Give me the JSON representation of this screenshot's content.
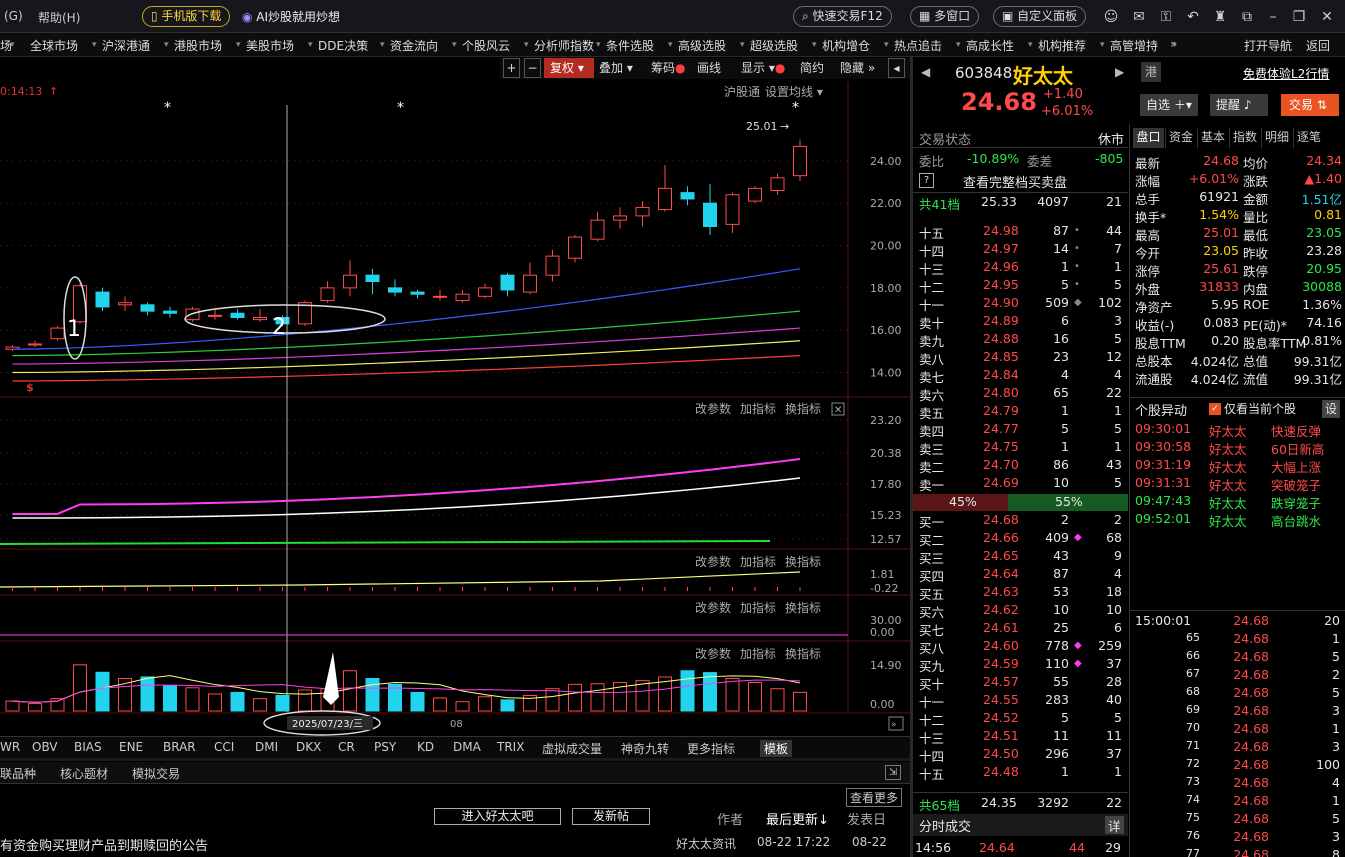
{
  "menu": {
    "left": "(G)",
    "help": "帮助(H)",
    "mobile": "手机版下载",
    "ai": "AI炒股就用炒想",
    "quick_trade": "快速交易F12",
    "multi_window": "多窗口",
    "custom_panel": "自定义面板"
  },
  "nav": [
    "场",
    "全球市场",
    "沪深港通",
    "港股市场",
    "美股市场",
    "DDE决策",
    "资金流向",
    "个股风云",
    "分析师指数",
    "条件选股",
    "高级选股",
    "超级选股",
    "机构增仓",
    "热点追击",
    "高成长性",
    "机构推荐",
    "高管增持"
  ],
  "nav_right": {
    "more": "»",
    "open_nav": "打开导航",
    "back": "返回"
  },
  "chart": {
    "toolbar": {
      "fuquan": "复权",
      "diejia": "叠加",
      "chouma": "筹码",
      "huaxian": "画线",
      "xianshi": "显示",
      "jianyue": "简约",
      "yincang": "隐藏"
    },
    "time_label": "0:14:13",
    "hgt": "沪股通",
    "ma_setting": "设置均线",
    "price_axis": [
      "24.00",
      "22.00",
      "20.00",
      "18.00",
      "16.00",
      "14.00"
    ],
    "high_label": "25.01",
    "annotations": [
      "1",
      "2"
    ],
    "panel_buttons": [
      "改参数",
      "加指标",
      "换指标"
    ],
    "p2_axis": [
      "23.20",
      "20.38",
      "17.80",
      "15.23",
      "12.57"
    ],
    "p3_axis": [
      "1.81",
      "-0.22"
    ],
    "p4_axis": [
      "30.00",
      "0.00"
    ],
    "p5_axis": [
      "14.90",
      "0.00"
    ],
    "date_label": "2025/07/23/三",
    "month_label": "08",
    "dollar_mark": "$"
  },
  "chart_data": {
    "type": "candlestick",
    "ohlc": [
      [
        15.1,
        15.3,
        15.0,
        15.2
      ],
      [
        15.3,
        15.5,
        15.2,
        15.35
      ],
      [
        15.6,
        16.2,
        15.5,
        16.1
      ],
      [
        16.4,
        18.2,
        16.3,
        18.1
      ],
      [
        17.8,
        18.0,
        16.9,
        17.1
      ],
      [
        17.2,
        17.6,
        16.9,
        17.3
      ],
      [
        17.2,
        17.3,
        16.7,
        16.9
      ],
      [
        16.9,
        17.1,
        16.6,
        16.8
      ],
      [
        16.5,
        17.1,
        16.4,
        17.0
      ],
      [
        16.7,
        17.0,
        16.5,
        16.7
      ],
      [
        16.8,
        17.0,
        16.5,
        16.6
      ],
      [
        16.5,
        17.0,
        16.4,
        16.6
      ],
      [
        16.6,
        16.7,
        16.2,
        16.3
      ],
      [
        16.3,
        17.4,
        16.2,
        17.3
      ],
      [
        17.4,
        18.3,
        17.3,
        18.0
      ],
      [
        18.0,
        19.3,
        17.6,
        18.6
      ],
      [
        18.6,
        18.9,
        17.7,
        18.3
      ],
      [
        18.0,
        18.4,
        17.6,
        17.8
      ],
      [
        17.8,
        17.9,
        17.5,
        17.7
      ],
      [
        17.6,
        17.9,
        17.4,
        17.6
      ],
      [
        17.4,
        17.9,
        17.3,
        17.7
      ],
      [
        17.6,
        18.2,
        17.5,
        18.0
      ],
      [
        18.6,
        18.7,
        17.6,
        17.9
      ],
      [
        17.8,
        19.2,
        17.7,
        18.6
      ],
      [
        18.6,
        19.8,
        18.3,
        19.5
      ],
      [
        19.4,
        20.5,
        19.2,
        20.4
      ],
      [
        20.3,
        21.6,
        20.2,
        21.2
      ],
      [
        21.2,
        21.8,
        20.8,
        21.4
      ],
      [
        21.4,
        22.1,
        20.9,
        21.8
      ],
      [
        21.7,
        23.8,
        21.6,
        22.7
      ],
      [
        22.5,
        22.8,
        21.9,
        22.2
      ],
      [
        22.0,
        22.9,
        20.5,
        20.9
      ],
      [
        21.0,
        22.5,
        20.6,
        22.4
      ],
      [
        22.1,
        22.8,
        22.0,
        22.7
      ],
      [
        22.6,
        23.4,
        22.4,
        23.2
      ],
      [
        23.3,
        25.01,
        23.05,
        24.68
      ]
    ],
    "ma_lines": [
      {
        "color": "#3a5bff"
      },
      {
        "color": "#2ecc40"
      },
      {
        "color": "#e040e0"
      },
      {
        "color": "#f0f060"
      },
      {
        "color": "#ff4040"
      }
    ],
    "volume": [
      3.2,
      2.4,
      4.0,
      14.9,
      12.5,
      10.5,
      11.0,
      8.2,
      7.5,
      5.5,
      6.0,
      4.0,
      5.0,
      6.8,
      7.2,
      13.0,
      10.5,
      8.6,
      6.0,
      4.2,
      3.0,
      4.6,
      3.6,
      5.0,
      7.2,
      8.6,
      8.8,
      9.2,
      9.8,
      11.0,
      13.0,
      12.4,
      10.5,
      9.2,
      7.2,
      6.0
    ],
    "ylim": [
      13.6,
      25.6
    ]
  },
  "indicators": [
    "WR",
    "OBV",
    "BIAS",
    "ENE",
    "BRAR",
    "CCI",
    "DMI",
    "DKX",
    "CR",
    "PSY",
    "KD",
    "DMA",
    "TRIX",
    "虚拟成交量",
    "神奇九转",
    "更多指标",
    "模板"
  ],
  "bottom": {
    "tabs": [
      "联品种",
      "核心题材",
      "模拟交易"
    ],
    "more": "查看更多",
    "enter": "进入好太太吧",
    "post": "发新帖",
    "author": "作者",
    "last_update": "最后更新",
    "post_date": "发表日",
    "news1": "有资金购买理财产品到期赎回的公告",
    "news_src": "好太太资讯",
    "news_time": "08-22 17:22",
    "news_date": "08-22"
  },
  "stock": {
    "code": "603848",
    "name": "好太太",
    "price": "24.68",
    "change": "+1.40",
    "pct": "+6.01%",
    "hk": "港",
    "l2": "免费体验L2行情",
    "zixuan": "自选",
    "remind": "提醒",
    "trade": "交易"
  },
  "order": {
    "status_label": "交易状态",
    "status": "休市",
    "weibi_label": "委比",
    "weibi": "-10.89%",
    "weicha_label": "委差",
    "weicha": "-805",
    "full_book": "查看完整档买卖盘",
    "total_sell": [
      "共41档",
      "25.33",
      "4097",
      "21"
    ],
    "sells": [
      [
        "十五",
        "24.98",
        "87",
        "44"
      ],
      [
        "十四",
        "24.97",
        "14",
        "7"
      ],
      [
        "十三",
        "24.96",
        "1",
        "1"
      ],
      [
        "十二",
        "24.95",
        "5",
        "5"
      ],
      [
        "十一",
        "24.90",
        "509",
        "102"
      ],
      [
        "卖十",
        "24.89",
        "6",
        "3"
      ],
      [
        "卖九",
        "24.88",
        "16",
        "5"
      ],
      [
        "卖八",
        "24.85",
        "23",
        "12"
      ],
      [
        "卖七",
        "24.84",
        "4",
        "4"
      ],
      [
        "卖六",
        "24.80",
        "65",
        "22"
      ],
      [
        "卖五",
        "24.79",
        "1",
        "1"
      ],
      [
        "卖四",
        "24.77",
        "5",
        "5"
      ],
      [
        "卖三",
        "24.75",
        "1",
        "1"
      ],
      [
        "卖二",
        "24.70",
        "86",
        "43"
      ],
      [
        "卖一",
        "24.69",
        "10",
        "5"
      ]
    ],
    "ratio_left": "45%",
    "ratio_right": "55%",
    "buys": [
      [
        "买一",
        "24.68",
        "2",
        "2"
      ],
      [
        "买二",
        "24.66",
        "409",
        "68"
      ],
      [
        "买三",
        "24.65",
        "43",
        "9"
      ],
      [
        "买四",
        "24.64",
        "87",
        "4"
      ],
      [
        "买五",
        "24.63",
        "53",
        "18"
      ],
      [
        "买六",
        "24.62",
        "10",
        "10"
      ],
      [
        "买七",
        "24.61",
        "25",
        "6"
      ],
      [
        "买八",
        "24.60",
        "778",
        "259"
      ],
      [
        "买九",
        "24.59",
        "110",
        "37"
      ],
      [
        "买十",
        "24.57",
        "55",
        "28"
      ],
      [
        "十一",
        "24.55",
        "283",
        "40"
      ],
      [
        "十二",
        "24.52",
        "5",
        "5"
      ],
      [
        "十三",
        "24.51",
        "11",
        "11"
      ],
      [
        "十四",
        "24.50",
        "296",
        "37"
      ],
      [
        "十五",
        "24.48",
        "1",
        "1"
      ]
    ],
    "total_buy": [
      "共65档",
      "24.35",
      "3292",
      "22"
    ],
    "fenshi_label": "分时成交",
    "detail": "详",
    "last_trade": [
      "14:56",
      "24.64",
      "44",
      "29"
    ]
  },
  "tabs": [
    "盘口",
    "资金",
    "基本",
    "指数",
    "明细",
    "逐笔"
  ],
  "quote": [
    [
      "最新",
      "24.68",
      "均价",
      "24.34"
    ],
    [
      "涨幅",
      "+6.01%",
      "涨跌",
      "▲1.40"
    ],
    [
      "总手",
      "61921",
      "金额",
      "1.51亿"
    ],
    [
      "换手*",
      "1.54%",
      "量比",
      "0.81"
    ],
    [
      "最高",
      "25.01",
      "最低",
      "23.05"
    ],
    [
      "今开",
      "23.05",
      "昨收",
      "23.28"
    ],
    [
      "涨停",
      "25.61",
      "跌停",
      "20.95"
    ],
    [
      "外盘",
      "31833",
      "内盘",
      "30088"
    ],
    [
      "净资产",
      "5.95",
      "ROE",
      "1.36%"
    ],
    [
      "收益(-)",
      "0.083",
      "PE(动)*",
      "74.16"
    ],
    [
      "股息TTM",
      "0.20",
      "股息率TTM",
      "0.81%"
    ],
    [
      "总股本",
      "4.024亿",
      "总值",
      "99.31亿"
    ],
    [
      "流通股",
      "4.024亿",
      "流值",
      "99.31亿"
    ]
  ],
  "alerts": {
    "title": "个股异动",
    "only": "仅看当前个股",
    "settings": "设",
    "rows": [
      [
        "09:30:01",
        "好太太",
        "快速反弹"
      ],
      [
        "09:30:58",
        "好太太",
        "60日新高"
      ],
      [
        "09:31:19",
        "好太太",
        "大幅上涨"
      ],
      [
        "09:31:31",
        "好太太",
        "突破笼子"
      ],
      [
        "09:47:43",
        "好太太",
        "跌穿笼子"
      ],
      [
        "09:52:01",
        "好太太",
        "高台跳水"
      ]
    ]
  },
  "ticks": [
    [
      "15:00:01",
      "24.68",
      "20"
    ],
    [
      "65",
      "24.68",
      "1"
    ],
    [
      "66",
      "24.68",
      "5"
    ],
    [
      "67",
      "24.68",
      "2"
    ],
    [
      "68",
      "24.68",
      "5"
    ],
    [
      "69",
      "24.68",
      "3"
    ],
    [
      "70",
      "24.68",
      "1"
    ],
    [
      "71",
      "24.68",
      "3"
    ],
    [
      "72",
      "24.68",
      "100"
    ],
    [
      "73",
      "24.68",
      "4"
    ],
    [
      "74",
      "24.68",
      "1"
    ],
    [
      "75",
      "24.68",
      "5"
    ],
    [
      "76",
      "24.68",
      "3"
    ],
    [
      "77",
      "24.68",
      "8"
    ]
  ]
}
